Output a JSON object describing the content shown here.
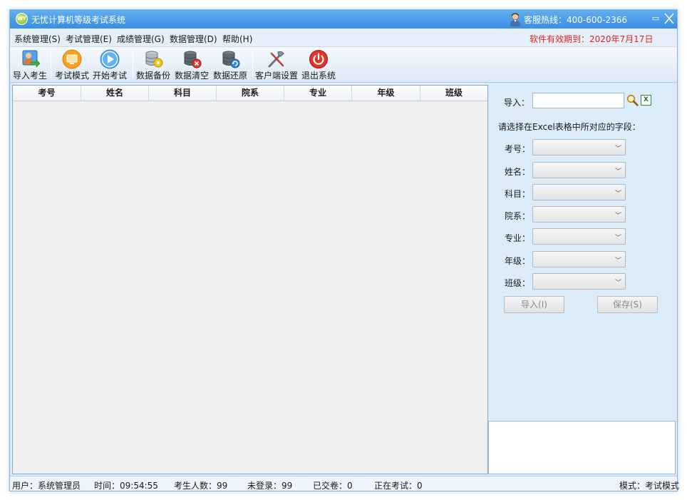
{
  "window": {
    "title": "无忧计算机等级考试系统",
    "logo_text": "WY",
    "hotline": "客服热线：400-600-2366",
    "expiry": "软件有效期到：2020年7月17日",
    "restore_glyph": "▭"
  },
  "menu": [
    "系统管理(S)",
    "考试管理(E)",
    "成绩管理(G)",
    "数据管理(D)",
    "帮助(H)"
  ],
  "toolbar": [
    {
      "label": "导入考生",
      "icon": "import-student-icon"
    },
    {
      "label": "考试模式",
      "icon": "exam-mode-icon"
    },
    {
      "label": "开始考试",
      "icon": "start-exam-icon"
    },
    {
      "label": "数据备份",
      "icon": "db-backup-icon"
    },
    {
      "label": "数据清空",
      "icon": "db-clear-icon"
    },
    {
      "label": "数据还原",
      "icon": "db-restore-icon"
    },
    {
      "label": "客户端设置",
      "icon": "client-settings-icon"
    },
    {
      "label": "退出系统",
      "icon": "power-icon"
    }
  ],
  "table": {
    "columns": [
      "考号",
      "姓名",
      "科目",
      "院系",
      "专业",
      "年级",
      "班级"
    ],
    "rows": []
  },
  "panel": {
    "import_label": "导入：",
    "import_value": "",
    "excel_glyph": "X",
    "hint": "请选择在Excel表格中所对应的字段：",
    "fields": [
      {
        "label": "考号：",
        "value": ""
      },
      {
        "label": "姓名：",
        "value": ""
      },
      {
        "label": "科目：",
        "value": ""
      },
      {
        "label": "院系：",
        "value": ""
      },
      {
        "label": "专业：",
        "value": ""
      },
      {
        "label": "年级：",
        "value": ""
      },
      {
        "label": "班级：",
        "value": ""
      }
    ],
    "import_button": "导入(I)",
    "save_button": "保存(S)"
  },
  "status": {
    "user": "用户：系统管理员",
    "time": "时间：09:54:55",
    "students": "考生人数：99",
    "not_logged": "未登录：99",
    "submitted": "已交卷：0",
    "in_exam": "正在考试：0",
    "mode": "模式：考试模式"
  },
  "colors": {
    "titlebar": "#3a8fe0",
    "expiry_red": "#e0231a",
    "panel_bg": "#dcebf8",
    "grid_bg": "#f0f0f0"
  }
}
